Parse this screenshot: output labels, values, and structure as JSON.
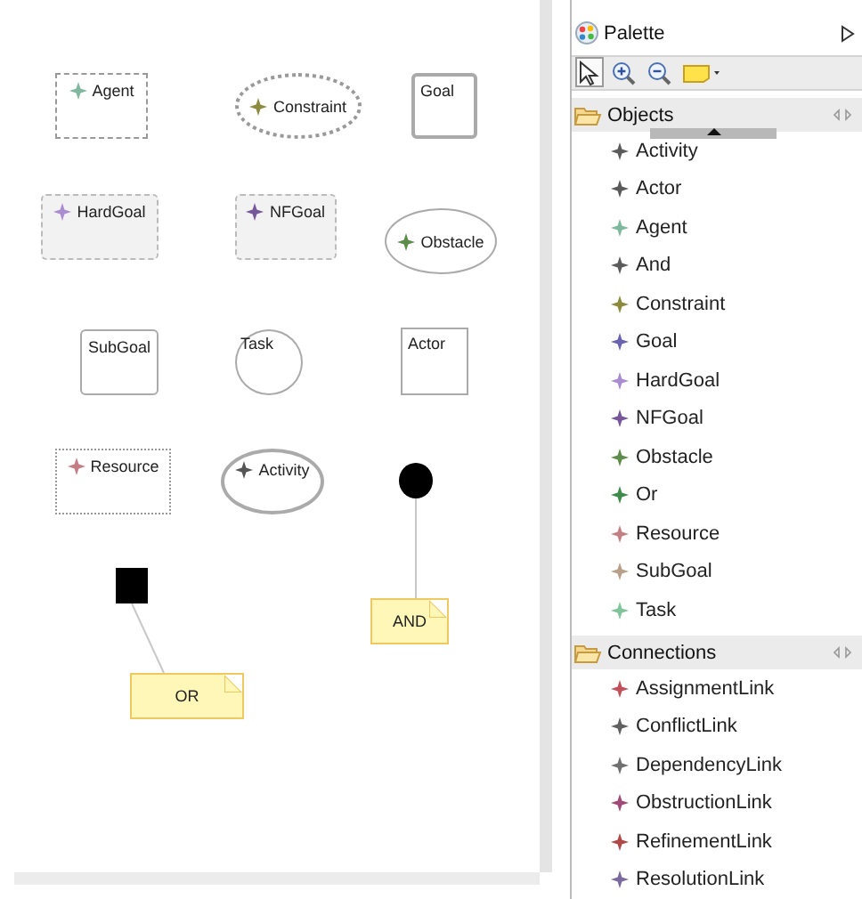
{
  "canvas": {
    "nodes": [
      {
        "kind": "dashed-box",
        "label": "Agent",
        "color": "#7fb89e"
      },
      {
        "kind": "dotted-ellipse",
        "label": "Constraint",
        "color": "#8c8a3e"
      },
      {
        "kind": "framed-box",
        "label": "Goal"
      },
      {
        "kind": "shaded-box",
        "label": "HardGoal",
        "color": "#a98dd0"
      },
      {
        "kind": "shaded-box",
        "label": "NFGoal",
        "color": "#76589a"
      },
      {
        "kind": "ellipse",
        "label": "Obstacle",
        "color": "#5e8c4c"
      },
      {
        "kind": "rounded-box",
        "label": "SubGoal"
      },
      {
        "kind": "circle",
        "label": "Task"
      },
      {
        "kind": "plain-box",
        "label": "Actor"
      },
      {
        "kind": "dotted-box",
        "label": "Resource",
        "color": "#c47f86"
      },
      {
        "kind": "thick-ellipse",
        "label": "Activity",
        "color": "#555555"
      },
      {
        "kind": "dot"
      },
      {
        "kind": "square"
      },
      {
        "kind": "note",
        "label": "AND"
      },
      {
        "kind": "note",
        "label": "OR"
      }
    ]
  },
  "palette": {
    "title": "Palette",
    "tools": [
      {
        "kind": "select",
        "selected": true
      },
      {
        "kind": "zoom-in",
        "selected": false
      },
      {
        "kind": "zoom-out",
        "selected": false
      },
      {
        "kind": "note",
        "selected": false
      }
    ],
    "drawers": [
      {
        "title": "Objects",
        "items": [
          {
            "label": "Activity",
            "color": "#5a5a5a"
          },
          {
            "label": "Actor",
            "color": "#5a5a5a"
          },
          {
            "label": "Agent",
            "color": "#7fb89e"
          },
          {
            "label": "And",
            "color": "#5a5a5a"
          },
          {
            "label": "Constraint",
            "color": "#8c8a3e"
          },
          {
            "label": "Goal",
            "color": "#6a64b0"
          },
          {
            "label": "HardGoal",
            "color": "#a98dd0"
          },
          {
            "label": "NFGoal",
            "color": "#76589a"
          },
          {
            "label": "Obstacle",
            "color": "#5e8c4c"
          },
          {
            "label": "Or",
            "color": "#3e8c4c"
          },
          {
            "label": "Resource",
            "color": "#c47f86"
          },
          {
            "label": "SubGoal",
            "color": "#b8a088"
          },
          {
            "label": "Task",
            "color": "#7fc49a"
          }
        ]
      },
      {
        "title": "Connections",
        "items": [
          {
            "label": "AssignmentLink",
            "color": "#c0505a"
          },
          {
            "label": "ConflictLink",
            "color": "#606060"
          },
          {
            "label": "DependencyLink",
            "color": "#707070"
          },
          {
            "label": "ObstructionLink",
            "color": "#a04a78"
          },
          {
            "label": "RefinementLink",
            "color": "#b04848"
          },
          {
            "label": "ResolutionLink",
            "color": "#7a6aa0"
          }
        ]
      }
    ]
  }
}
